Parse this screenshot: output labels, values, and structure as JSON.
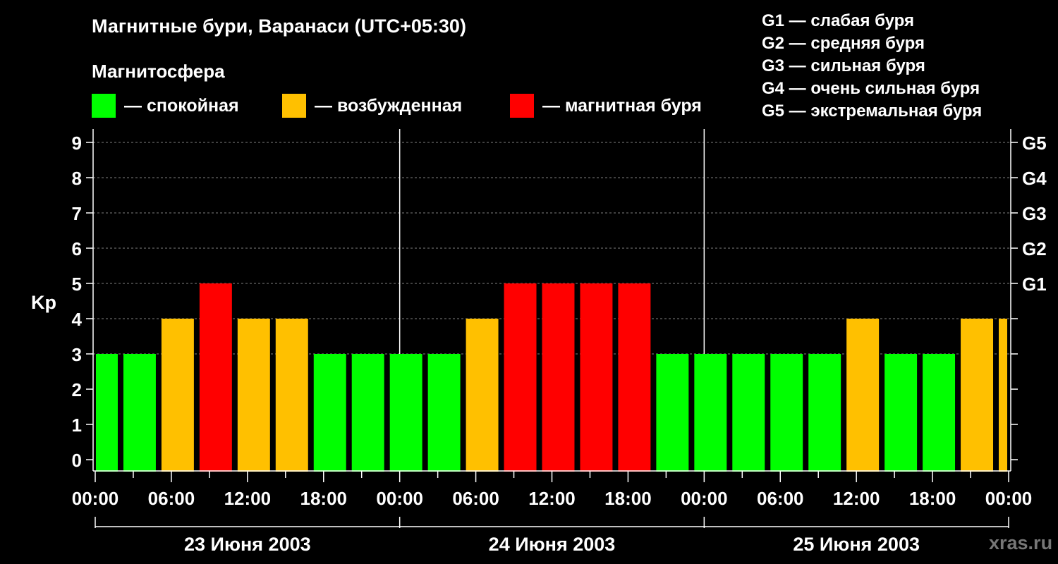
{
  "title": "Магнитные бури, Варанаси (UTC+05:30)",
  "subtitle": "Магнитосфера",
  "colors": {
    "quiet": "#00ff00",
    "excited": "#ffc000",
    "storm": "#ff0000",
    "background": "#000000",
    "watermark": "#777777"
  },
  "legend": [
    {
      "label": "— спокойная",
      "color": "#00ff00"
    },
    {
      "label": "— возбужденная",
      "color": "#ffc000"
    },
    {
      "label": "— магнитная буря",
      "color": "#ff0000"
    }
  ],
  "g_levels": [
    "G1 — слабая буря",
    "G2 — средняя буря",
    "G3 — сильная буря",
    "G4 — очень сильная буря",
    "G5 — экстремальная буря"
  ],
  "watermark": "xras.ru",
  "chart_data": {
    "type": "bar",
    "ylabel": "Kp",
    "ylim": [
      0,
      9
    ],
    "y_ticks": [
      "0",
      "1",
      "2",
      "3",
      "4",
      "5",
      "6",
      "7",
      "8",
      "9"
    ],
    "right_ticks": [
      {
        "kp": 5,
        "label": "G1"
      },
      {
        "kp": 6,
        "label": "G2"
      },
      {
        "kp": 7,
        "label": "G3"
      },
      {
        "kp": 8,
        "label": "G4"
      },
      {
        "kp": 9,
        "label": "G5"
      }
    ],
    "x_tick_labels": [
      "00:00",
      "06:00",
      "12:00",
      "18:00",
      "00:00",
      "06:00",
      "12:00",
      "18:00",
      "00:00",
      "06:00",
      "12:00",
      "18:00",
      "00:00"
    ],
    "days": [
      "23 Июня 2003",
      "24 Июня 2003",
      "25 Июня 2003"
    ],
    "grid": "dashed horizontal lines",
    "bars": [
      {
        "start": "23 Июня 2003 00:00",
        "kp": 3,
        "level": "quiet"
      },
      {
        "start": "23 Июня 2003 02:00",
        "kp": 3,
        "level": "quiet"
      },
      {
        "start": "23 Июня 2003 05:00",
        "kp": 4,
        "level": "excited"
      },
      {
        "start": "23 Июня 2003 08:00",
        "kp": 5,
        "level": "storm"
      },
      {
        "start": "23 Июня 2003 11:00",
        "kp": 4,
        "level": "excited"
      },
      {
        "start": "23 Июня 2003 14:00",
        "kp": 4,
        "level": "excited"
      },
      {
        "start": "23 Июня 2003 17:00",
        "kp": 3,
        "level": "quiet"
      },
      {
        "start": "23 Июня 2003 20:00",
        "kp": 3,
        "level": "quiet"
      },
      {
        "start": "23 Июня 2003 23:00",
        "kp": 3,
        "level": "quiet"
      },
      {
        "start": "24 Июня 2003 02:00",
        "kp": 3,
        "level": "quiet"
      },
      {
        "start": "24 Июня 2003 05:00",
        "kp": 4,
        "level": "excited"
      },
      {
        "start": "24 Июня 2003 08:00",
        "kp": 5,
        "level": "storm"
      },
      {
        "start": "24 Июня 2003 11:00",
        "kp": 5,
        "level": "storm"
      },
      {
        "start": "24 Июня 2003 14:00",
        "kp": 5,
        "level": "storm"
      },
      {
        "start": "24 Июня 2003 17:00",
        "kp": 5,
        "level": "storm"
      },
      {
        "start": "24 Июня 2003 20:00",
        "kp": 3,
        "level": "quiet"
      },
      {
        "start": "24 Июня 2003 23:00",
        "kp": 3,
        "level": "quiet"
      },
      {
        "start": "25 Июня 2003 02:00",
        "kp": 3,
        "level": "quiet"
      },
      {
        "start": "25 Июня 2003 05:00",
        "kp": 3,
        "level": "quiet"
      },
      {
        "start": "25 Июня 2003 08:00",
        "kp": 3,
        "level": "quiet"
      },
      {
        "start": "25 Июня 2003 11:00",
        "kp": 4,
        "level": "excited"
      },
      {
        "start": "25 Июня 2003 14:00",
        "kp": 3,
        "level": "quiet"
      },
      {
        "start": "25 Июня 2003 17:00",
        "kp": 3,
        "level": "quiet"
      },
      {
        "start": "25 Июня 2003 20:00",
        "kp": 4,
        "level": "excited"
      },
      {
        "start": "25 Июня 2003 23:00",
        "kp": 4,
        "level": "excited"
      }
    ]
  }
}
